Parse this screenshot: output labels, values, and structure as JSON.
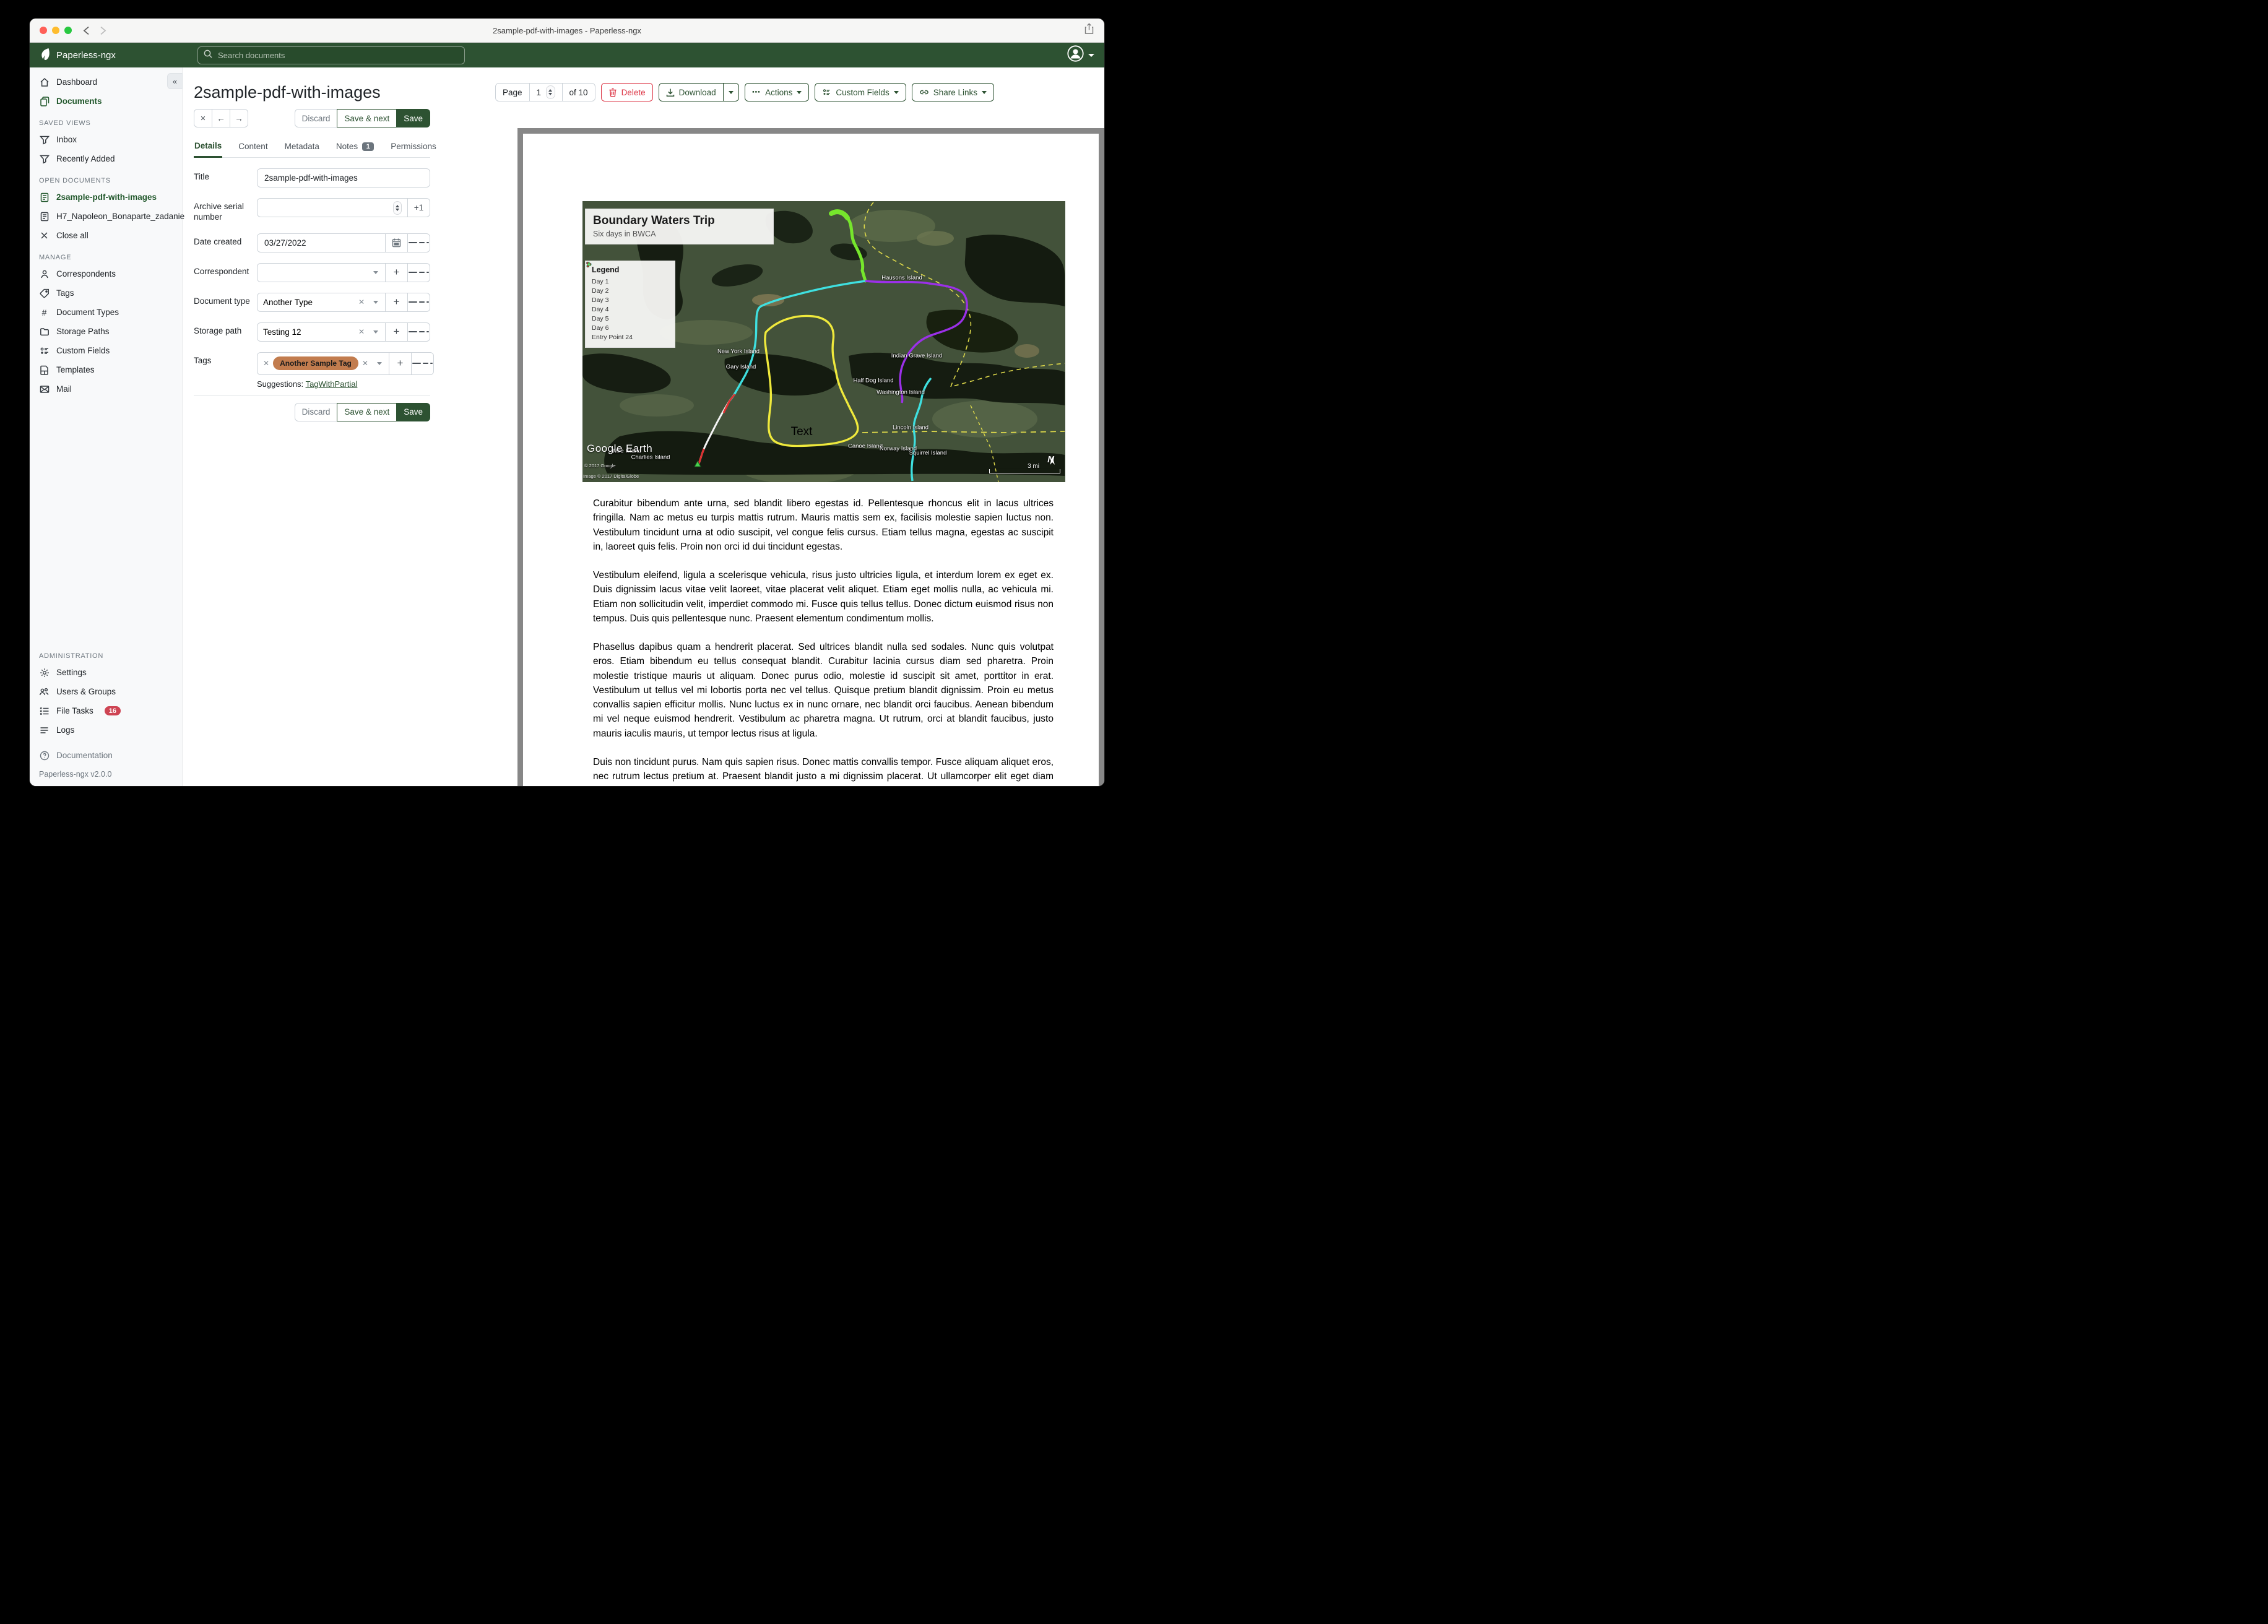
{
  "colors": {
    "brand_green": "#2d5232",
    "danger_red": "#dc3545",
    "tag_orange": "#c27c4e",
    "badge_gray": "#6c757d"
  },
  "window": {
    "title": "2sample-pdf-with-images - Paperless-ngx"
  },
  "header": {
    "app_name": "Paperless-ngx",
    "search_placeholder": "Search documents"
  },
  "sidebar": {
    "items_top": [
      {
        "label": "Dashboard"
      },
      {
        "label": "Documents"
      }
    ],
    "saved_views_title": "SAVED VIEWS",
    "saved_views": [
      {
        "label": "Inbox"
      },
      {
        "label": "Recently Added"
      }
    ],
    "open_documents_title": "OPEN DOCUMENTS",
    "open_documents": [
      {
        "label": "2sample-pdf-with-images"
      },
      {
        "label": "H7_Napoleon_Bonaparte_zadanie"
      }
    ],
    "close_all": "Close all",
    "manage_title": "MANAGE",
    "manage": [
      {
        "label": "Correspondents"
      },
      {
        "label": "Tags"
      },
      {
        "label": "Document Types"
      },
      {
        "label": "Storage Paths"
      },
      {
        "label": "Custom Fields"
      },
      {
        "label": "Templates"
      },
      {
        "label": "Mail"
      }
    ],
    "admin_title": "ADMINISTRATION",
    "admin": [
      {
        "label": "Settings"
      },
      {
        "label": "Users & Groups"
      },
      {
        "label": "File Tasks",
        "badge": "16"
      },
      {
        "label": "Logs"
      }
    ],
    "documentation": "Documentation",
    "version": "Paperless-ngx v2.0.0"
  },
  "toolbar": {
    "page_label": "Page",
    "page_value": "1",
    "page_total": "of 10",
    "delete_label": "Delete",
    "download_label": "Download",
    "actions_label": "Actions",
    "actions_dots": "⋯",
    "custom_fields_label": "Custom Fields",
    "share_links_label": "Share Links"
  },
  "doc": {
    "title": "2sample-pdf-with-images"
  },
  "edit_actions": {
    "discard": "Discard",
    "save_next": "Save & next",
    "save": "Save",
    "close": "✕",
    "prev": "←",
    "next": "→"
  },
  "tabs": {
    "details": "Details",
    "content": "Content",
    "metadata": "Metadata",
    "notes": "Notes",
    "notes_badge": "1",
    "permissions": "Permissions"
  },
  "form": {
    "title_label": "Title",
    "title_value": "2sample-pdf-with-images",
    "asn_label": "Archive serial number",
    "asn_value": "",
    "asn_plus": "+1",
    "date_label": "Date created",
    "date_value": "03/27/2022",
    "correspondent_label": "Correspondent",
    "correspondent_value": "",
    "doctype_label": "Document type",
    "doctype_value": "Another Type",
    "storage_label": "Storage path",
    "storage_value": "Testing 12",
    "tags_label": "Tags",
    "tag_chip": "Another Sample Tag",
    "suggestions_label": "Suggestions:",
    "suggestion_link": "TagWithPartial"
  },
  "preview": {
    "map": {
      "title": "Boundary Waters Trip",
      "subtitle": "Six days in BWCA",
      "legend_title": "Legend",
      "legend": [
        {
          "label": "Day 1",
          "color": "#a8b8a8"
        },
        {
          "label": "Day 2",
          "color": "#d6d64e"
        },
        {
          "label": "Day 3",
          "color": "#8f3fd6"
        },
        {
          "label": "Day 4",
          "color": "#77d63f"
        },
        {
          "label": "Day 5",
          "color": "#4fc8c8"
        },
        {
          "label": "Day 6",
          "color": "#b23232"
        },
        {
          "label": "Entry Point 24",
          "color": "#3fb53f"
        }
      ],
      "labels": [
        {
          "text": "Hausons Island"
        },
        {
          "text": "New York Island"
        },
        {
          "text": "Gary Island"
        },
        {
          "text": "Indian Grave Island"
        },
        {
          "text": "Half Dog Island"
        },
        {
          "text": "Washington Island"
        },
        {
          "text": "Lincoln Island"
        },
        {
          "text": "Canoe Island"
        },
        {
          "text": "Norway Island"
        },
        {
          "text": "Squirrel Island"
        },
        {
          "text": "Mile Island"
        },
        {
          "text": "Charlies Island"
        }
      ],
      "annotation": "Text",
      "credit": "Google Earth",
      "attribution1": "© 2017 Google",
      "attribution2": "Image © 2017 DigitalGlobe",
      "scale_label": "3 mi",
      "compass": "N"
    },
    "paragraphs": [
      "Curabitur bibendum ante urna, sed blandit libero egestas id. Pellentesque rhoncus elit in lacus ultrices fringilla. Nam ac metus eu turpis mattis rutrum. Mauris mattis sem ex, facilisis molestie sapien luctus non. Vestibulum tincidunt urna at odio suscipit, vel congue felis cursus. Etiam tellus magna, egestas ac suscipit in, laoreet quis felis. Proin non orci id dui tincidunt egestas.",
      "Vestibulum eleifend, ligula a scelerisque vehicula, risus justo ultricies ligula, et interdum lorem ex eget ex. Duis dignissim lacus vitae velit laoreet, vitae placerat velit aliquet. Etiam eget mollis nulla, ac vehicula mi. Etiam non sollicitudin velit, imperdiet commodo mi. Fusce quis tellus tellus. Donec dictum euismod risus non tempus. Duis quis pellentesque nunc. Praesent elementum condimentum mollis.",
      "Phasellus dapibus quam a hendrerit placerat. Sed ultrices blandit nulla sed sodales. Nunc quis volutpat eros. Etiam bibendum eu tellus consequat blandit. Curabitur lacinia cursus diam sed pharetra. Proin molestie tristique mauris ut aliquam. Donec purus odio, molestie id suscipit sit amet, porttitor in erat. Vestibulum ut tellus vel mi lobortis porta nec vel tellus. Quisque pretium blandit dignissim. Proin eu metus convallis sapien efficitur mollis. Nunc luctus ex in nunc ornare, nec blandit orci faucibus. Aenean bibendum mi vel neque euismod hendrerit. Vestibulum ac pharetra magna. Ut rutrum, orci at blandit faucibus, justo mauris iaculis mauris, ut tempor lectus risus at ligula.",
      "Duis non tincidunt purus. Nam quis sapien risus. Donec mattis convallis tempor. Fusce aliquam aliquet eros, nec rutrum lectus pretium at. Praesent blandit justo a mi dignissim placerat. Ut ullamcorper elit eget diam maximus iaculis. In bibendum in massa eget facilisis. In iaculis lectus"
    ]
  }
}
